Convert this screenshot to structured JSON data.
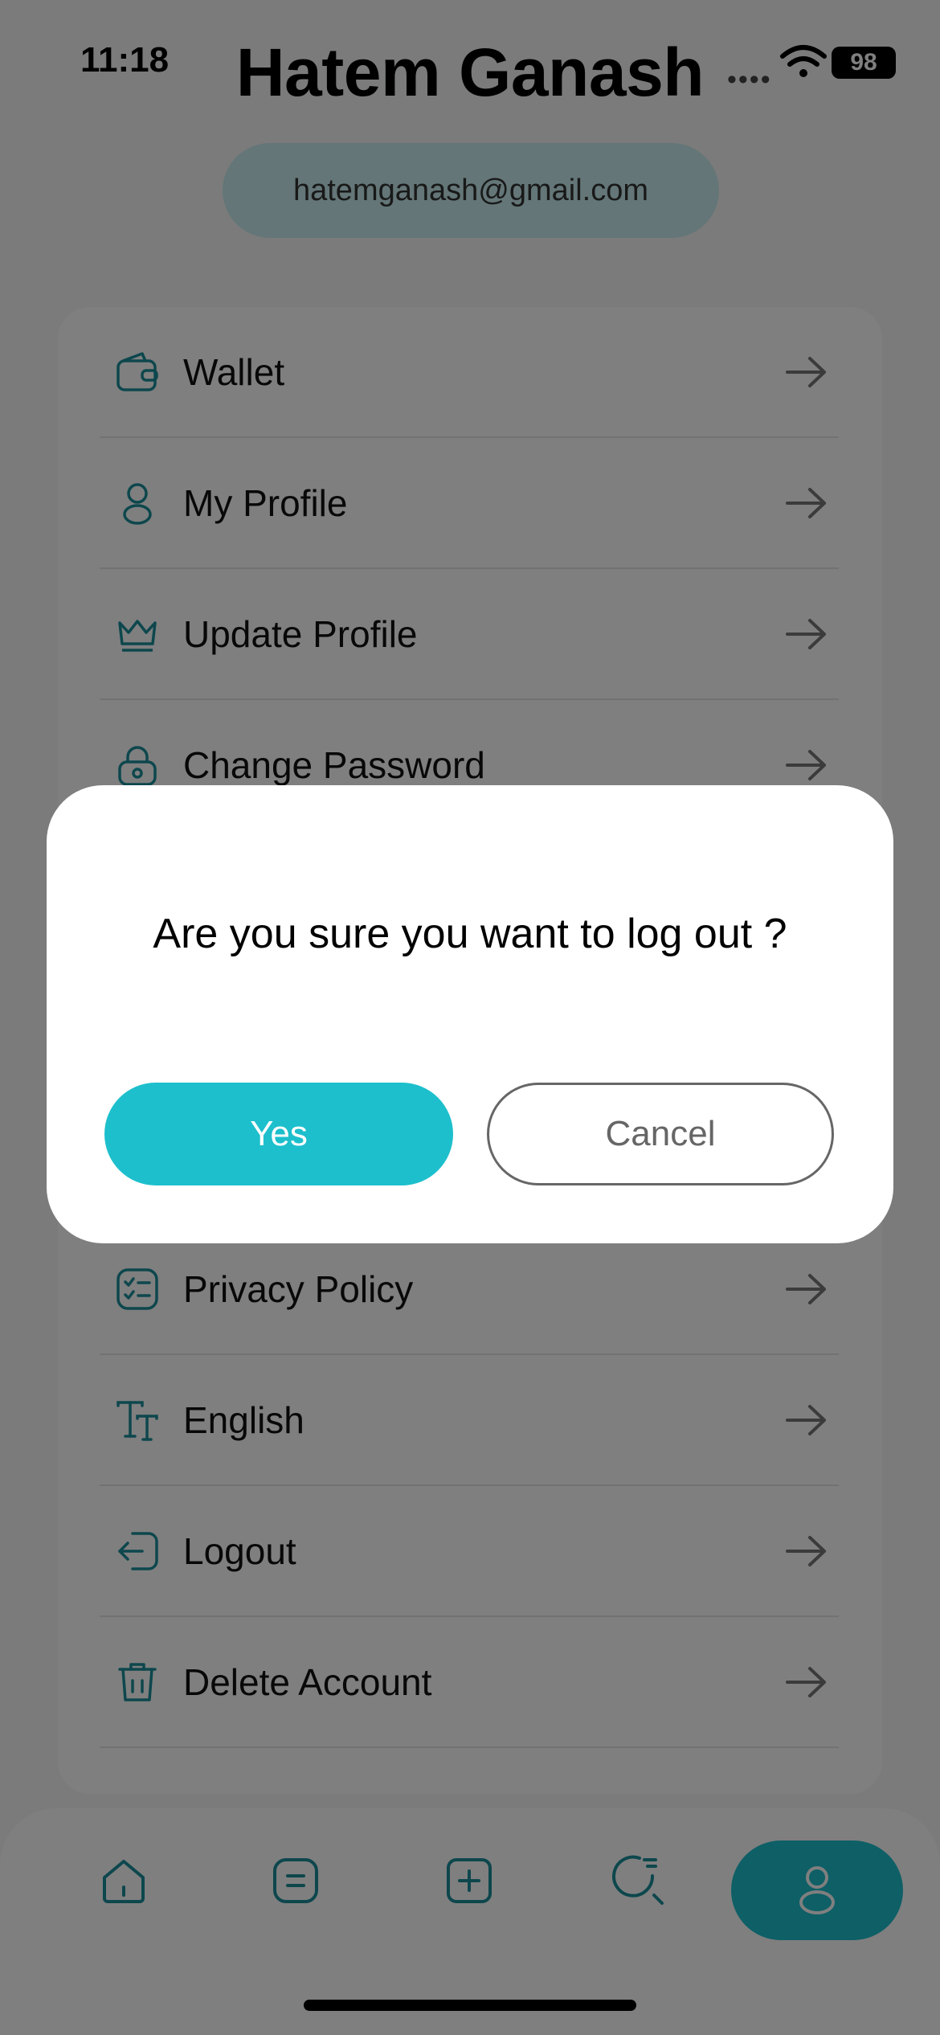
{
  "status": {
    "time": "11:18",
    "battery": "98"
  },
  "header": {
    "title": "Hatem Ganash",
    "email": "hatemganash@gmail.com"
  },
  "menu": {
    "items": [
      {
        "label": "Wallet",
        "icon": "wallet-icon"
      },
      {
        "label": "My Profile",
        "icon": "user-icon"
      },
      {
        "label": "Update Profile",
        "icon": "crown-icon"
      },
      {
        "label": "Change Password",
        "icon": "lock-icon"
      },
      {
        "label": "Privacy Policy",
        "icon": "checklist-icon"
      },
      {
        "label": "English",
        "icon": "text-size-icon"
      },
      {
        "label": "Logout",
        "icon": "logout-icon"
      },
      {
        "label": "Delete Account",
        "icon": "trash-icon"
      }
    ]
  },
  "dialog": {
    "message": "Are you sure you want to log out ?",
    "yes_label": "Yes",
    "cancel_label": "Cancel"
  },
  "tabbar": {
    "tabs": [
      "home-icon",
      "orders-icon",
      "add-icon",
      "search-icon",
      "profile-icon"
    ],
    "active": "profile-icon"
  },
  "colors": {
    "accent": "#1dbfcc",
    "icon": "#1a8f9a"
  }
}
